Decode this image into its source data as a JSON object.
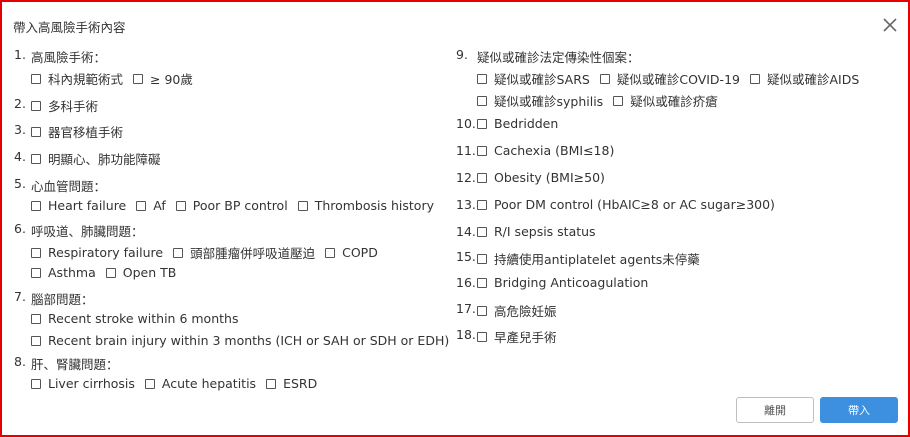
{
  "dialog": {
    "title": "帶入高風險手術內容",
    "cancel_label": "離開",
    "ok_label": "帶入"
  },
  "left": [
    {
      "num": "1.",
      "title": "高風險手術：",
      "rows": [
        [
          "科內規範術式",
          "≥ 90歲"
        ]
      ]
    },
    {
      "num": "2.",
      "options": [
        "多科手術"
      ]
    },
    {
      "num": "3.",
      "options": [
        "器官移植手術"
      ]
    },
    {
      "num": "4.",
      "options": [
        "明顯心、肺功能障礙"
      ]
    },
    {
      "num": "5.",
      "title": "心血管問題：",
      "rows": [
        [
          "Heart failure",
          "Af",
          "Poor BP control",
          "Thrombosis history"
        ]
      ]
    },
    {
      "num": "6.",
      "title": "呼吸道、肺臟問題：",
      "rows": [
        [
          "Respiratory failure",
          "頭部腫瘤併呼吸道壓迫",
          "COPD"
        ],
        [
          "Asthma",
          "Open TB"
        ]
      ]
    },
    {
      "num": "7.",
      "title": "腦部問題：",
      "rows": [
        [
          "Recent stroke within 6 months"
        ],
        [
          "Recent brain injury within 3 months (ICH or SAH or SDH or EDH)"
        ]
      ]
    },
    {
      "num": "8.",
      "title": "肝、腎臟問題：",
      "rows": [
        [
          "Liver cirrhosis",
          "Acute hepatitis",
          "ESRD"
        ]
      ]
    }
  ],
  "right": [
    {
      "num": "9.",
      "title": "疑似或確診法定傳染性個案：",
      "rows": [
        [
          "疑似或確診SARS",
          "疑似或確診COVID-19",
          "疑似或確診AIDS"
        ],
        [
          "疑似或確診syphilis",
          "疑似或確診疥瘡"
        ]
      ]
    },
    {
      "num": "10.",
      "options": [
        "Bedridden"
      ]
    },
    {
      "num": "11.",
      "options": [
        "Cachexia (BMI≤18)"
      ]
    },
    {
      "num": "12.",
      "options": [
        "Obesity (BMI≥50)"
      ]
    },
    {
      "num": "13.",
      "options": [
        "Poor DM control (HbAIC≥8 or AC sugar≥300)"
      ]
    },
    {
      "num": "14.",
      "options": [
        "R/I sepsis status"
      ]
    },
    {
      "num": "15.",
      "options": [
        "持續使用antiplatelet agents未停藥"
      ]
    },
    {
      "num": "16.",
      "options": [
        "Bridging Anticoagulation"
      ]
    },
    {
      "num": "17.",
      "options": [
        "高危險妊娠"
      ]
    },
    {
      "num": "18.",
      "options": [
        "早產兒手術"
      ]
    }
  ]
}
